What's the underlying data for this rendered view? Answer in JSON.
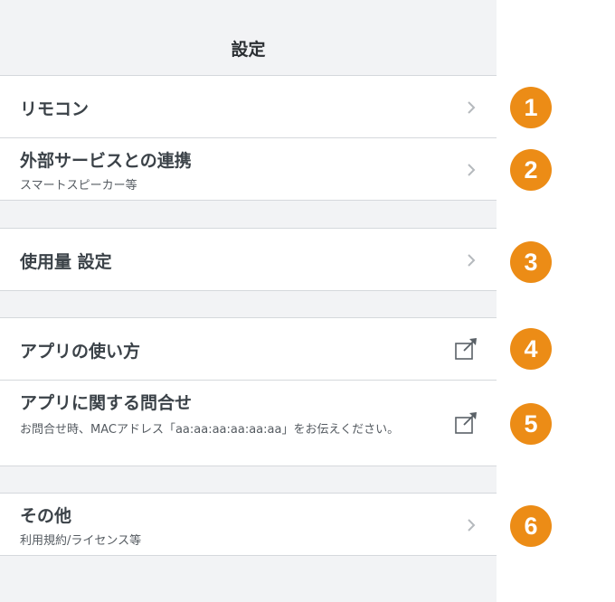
{
  "header": {
    "title": "設定"
  },
  "items": [
    {
      "label": "リモコン",
      "badge": "1"
    },
    {
      "label": "外部サービスとの連携",
      "sublabel": "スマートスピーカー等",
      "badge": "2"
    },
    {
      "label": "使用量 設定",
      "badge": "3"
    },
    {
      "label": "アプリの使い方",
      "badge": "4"
    },
    {
      "label": "アプリに関する問合せ",
      "sublabel": "お問合せ時、MACアドレス「aa:aa:aa:aa:aa:aa」をお伝えください。",
      "badge": "5"
    },
    {
      "label": "その他",
      "sublabel": "利用規約/ライセンス等",
      "badge": "6"
    }
  ],
  "icons": {
    "chevron": "chevron-right-icon",
    "external": "external-link-icon"
  },
  "colors": {
    "badge": "#ec8c16",
    "background": "#f2f3f5",
    "row": "#ffffff",
    "divider": "#d5d8dc"
  }
}
